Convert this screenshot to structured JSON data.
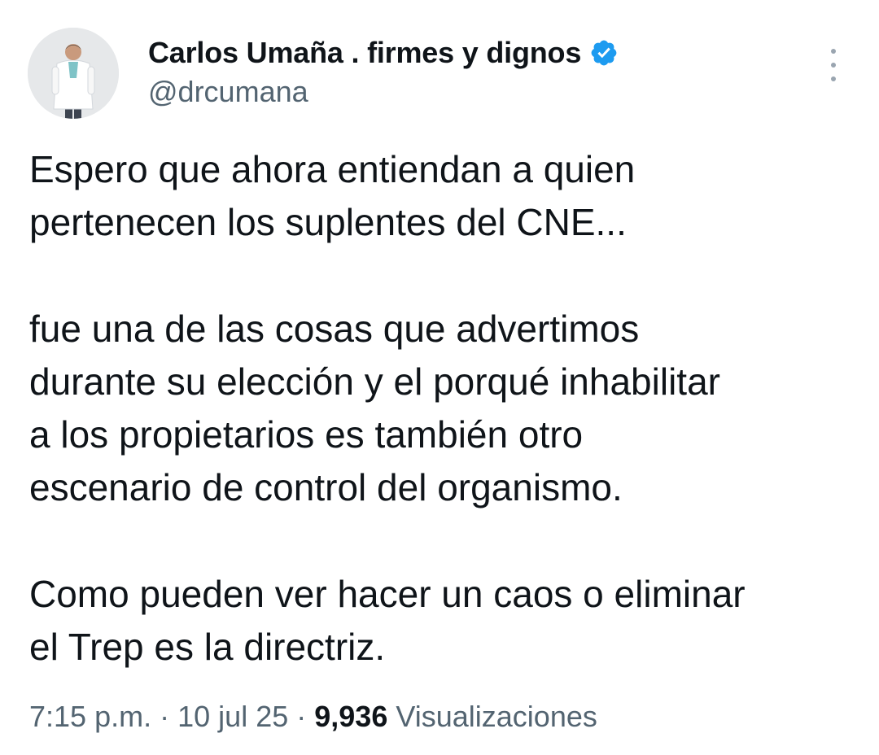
{
  "author": {
    "display_name": "Carlos Umaña . firmes y dignos",
    "handle": "@drcumana",
    "verified": true,
    "verified_color": "#1d9bf0",
    "avatar_icon": "profile-photo-doctor-white-coat"
  },
  "tweet": {
    "paragraph_1": "Espero que ahora entiendan a quien\npertenecen los suplentes del CNE...",
    "paragraph_2": " fue una de las cosas que advertimos\ndurante su elección y el porqué inhabilitar\na los propietarios es también otro\nescenario de control del organismo.",
    "paragraph_3": "Como pueden ver hacer un caos o eliminar\nel Trep es la directriz."
  },
  "meta": {
    "time": "7:15 p.m.",
    "separator": "·",
    "date": "10 jul 25",
    "views_count": "9,936",
    "views_label": "Visualizaciones"
  },
  "icons": {
    "more": "more-vertical-icon",
    "verified": "verified-badge-icon"
  }
}
